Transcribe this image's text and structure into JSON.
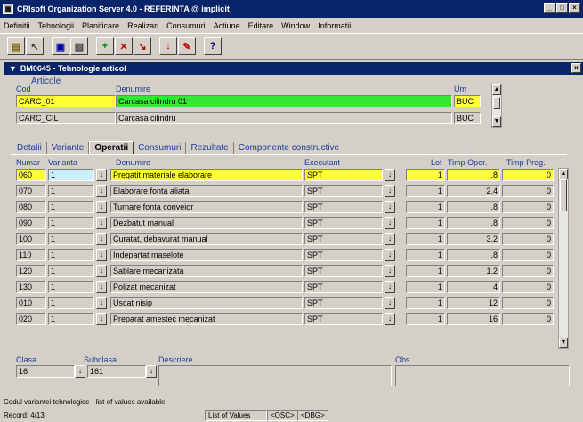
{
  "window": {
    "title": "CRIsoft Organization Server 4.0 - REFERINTA @ implicit",
    "btn_min": "_",
    "btn_max": "□",
    "btn_close": "×"
  },
  "menu": [
    "Definitii",
    "Tehnologii",
    "Planificare",
    "Realizari",
    "Consumuri",
    "Actiune",
    "Editare",
    "Window",
    "Informatii"
  ],
  "subwindow": {
    "title": "BM0645 - Tehnologie articol",
    "close": "×"
  },
  "articole": {
    "section_label": "Articole",
    "col_cod": "Cod",
    "col_denumire": "Denumire",
    "col_um": "Um",
    "rows": [
      {
        "cod": "CARC_01",
        "denumire": "Carcasa cilindru 01",
        "um": "BUC"
      },
      {
        "cod": "CARC_CIL",
        "denumire": "Carcasa cilindru",
        "um": "BUC"
      }
    ]
  },
  "tabs": [
    "Detalii",
    "Variante",
    "Operatii",
    "Consumuri",
    "Rezultate",
    "Componente constructive"
  ],
  "active_tab": "Operatii",
  "operatii": {
    "headers": {
      "numar": "Numar",
      "varianta": "Varianta",
      "denumire": "Denumire",
      "executant": "Executant",
      "lot": "Lot",
      "timp_oper": "Timp Oper.",
      "timp_preg": "Timp Preg."
    },
    "lov_glyph": "↓",
    "rows": [
      {
        "numar": "060",
        "varianta": "1",
        "denumire": "Pregatit materiale elaborare",
        "executant": "SPT",
        "lot": "1",
        "timp_oper": ".8",
        "timp_preg": "0"
      },
      {
        "numar": "070",
        "varianta": "1",
        "denumire": "Elaborare fonta aliata",
        "executant": "SPT",
        "lot": "1",
        "timp_oper": "2.4",
        "timp_preg": "0"
      },
      {
        "numar": "080",
        "varianta": "1",
        "denumire": "Turnare fonta conveior",
        "executant": "SPT",
        "lot": "1",
        "timp_oper": ".8",
        "timp_preg": "0"
      },
      {
        "numar": "090",
        "varianta": "1",
        "denumire": "Dezbatut manual",
        "executant": "SPT",
        "lot": "1",
        "timp_oper": ".8",
        "timp_preg": "0"
      },
      {
        "numar": "100",
        "varianta": "1",
        "denumire": "Curatat, debavurat manual",
        "executant": "SPT",
        "lot": "1",
        "timp_oper": "3.2",
        "timp_preg": "0"
      },
      {
        "numar": "110",
        "varianta": "1",
        "denumire": "Indepartat maselote",
        "executant": "SPT",
        "lot": "1",
        "timp_oper": ".8",
        "timp_preg": "0"
      },
      {
        "numar": "120",
        "varianta": "1",
        "denumire": "Sablare mecanizata",
        "executant": "SPT",
        "lot": "1",
        "timp_oper": "1.2",
        "timp_preg": "0"
      },
      {
        "numar": "130",
        "varianta": "1",
        "denumire": "Polizat mecanizat",
        "executant": "SPT",
        "lot": "1",
        "timp_oper": "4",
        "timp_preg": "0"
      },
      {
        "numar": "010",
        "varianta": "1",
        "denumire": "Uscat nisip",
        "executant": "SPT",
        "lot": "1",
        "timp_oper": "12",
        "timp_preg": "0"
      },
      {
        "numar": "020",
        "varianta": "1",
        "denumire": "Preparat amestec mecanizat",
        "executant": "SPT",
        "lot": "1",
        "timp_oper": "16",
        "timp_preg": "0"
      }
    ]
  },
  "details": {
    "clasa_label": "Clasa",
    "clasa_value": "16",
    "subclasa_label": "Subclasa",
    "subclasa_value": "161",
    "descriere_label": "Descriere",
    "descriere_value": "",
    "obs_label": "Obs",
    "obs_value": ""
  },
  "status": {
    "hint": "Codul variantei tehnologice - list of values available",
    "record": "Record: 4/13",
    "lov": "List of Values",
    "osc": "<OSC>",
    "dbg": "<DBG>"
  },
  "colors": {
    "titlebar": "#0a246a",
    "current_row": "#ffff33",
    "denumire_current": "#33e833",
    "label": "#1a3a9a"
  }
}
